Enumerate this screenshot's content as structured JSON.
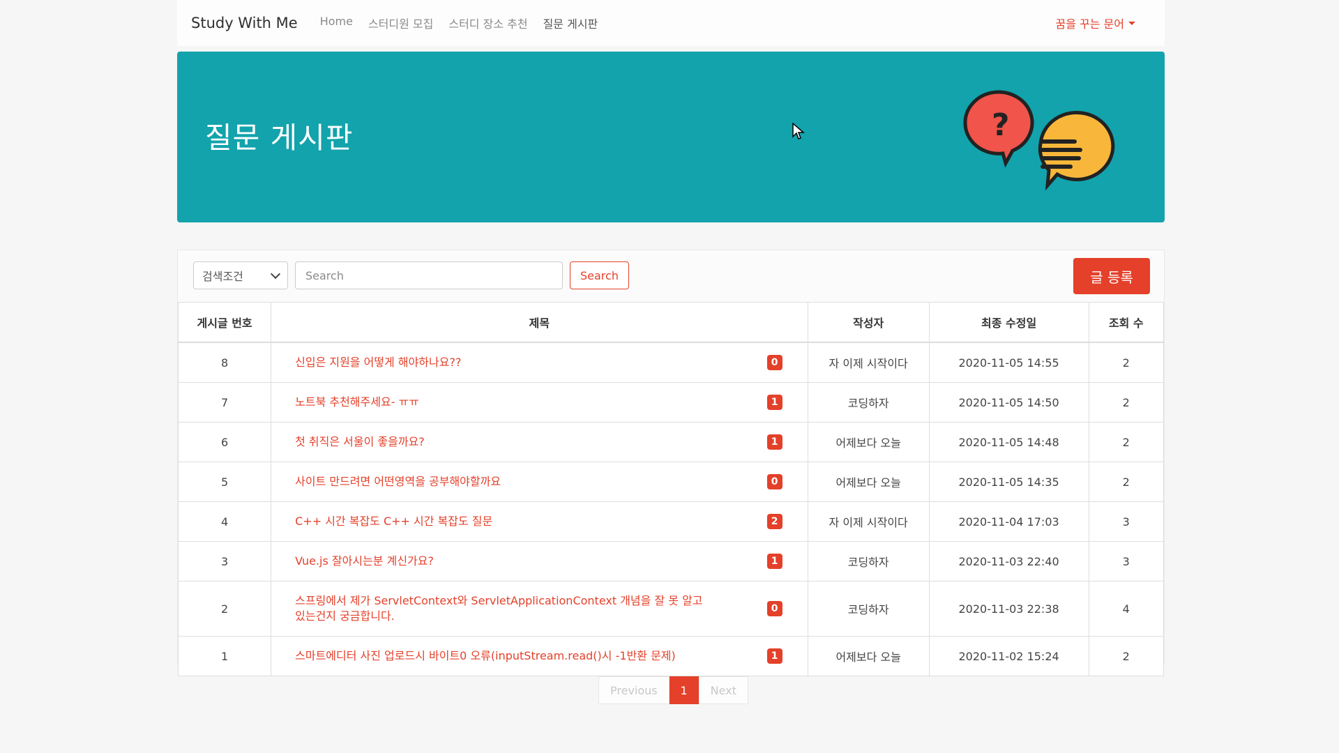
{
  "nav": {
    "brand": "Study With Me",
    "links": [
      "Home",
      "스터디원 모집",
      "스터디 장소 추천",
      "질문 게시판"
    ],
    "user": "꿈을 꾸는 문어"
  },
  "hero": {
    "title": "질문 게시판"
  },
  "toolbar": {
    "select_value": "검색조건",
    "search_placeholder": "Search",
    "search_button": "Search",
    "write_button": "글 등록"
  },
  "table": {
    "headers": [
      "게시글 번호",
      "제목",
      "작성자",
      "최종 수정일",
      "조회 수"
    ],
    "rows": [
      {
        "no": "8",
        "title": "신입은 지원을 어떻게 해야하나요??",
        "comments": "0",
        "author": "자 이제 시작이다",
        "date": "2020-11-05 14:55",
        "views": "2"
      },
      {
        "no": "7",
        "title": "노트북 추천해주세요- ㅠㅠ",
        "comments": "1",
        "author": "코딩하자",
        "date": "2020-11-05 14:50",
        "views": "2"
      },
      {
        "no": "6",
        "title": "첫 취직은 서울이 좋을까요?",
        "comments": "1",
        "author": "어제보다 오늘",
        "date": "2020-11-05 14:48",
        "views": "2"
      },
      {
        "no": "5",
        "title": "사이트 만드려면 어떤영역을 공부해야할까요",
        "comments": "0",
        "author": "어제보다 오늘",
        "date": "2020-11-05 14:35",
        "views": "2"
      },
      {
        "no": "4",
        "title": "C++ 시간 복잡도 C++ 시간 복잡도 질문",
        "comments": "2",
        "author": "자 이제 시작이다",
        "date": "2020-11-04 17:03",
        "views": "3"
      },
      {
        "no": "3",
        "title": "Vue.js 잘아시는분 계신가요?",
        "comments": "1",
        "author": "코딩하자",
        "date": "2020-11-03 22:40",
        "views": "3"
      },
      {
        "no": "2",
        "title": "스프링에서 제가 ServletContext와 ServletApplicationContext 개념을 잘 못 알고 있는건지 궁금합니다.",
        "comments": "0",
        "author": "코딩하자",
        "date": "2020-11-03 22:38",
        "views": "4"
      },
      {
        "no": "1",
        "title": "스마트에디터 사진 업로드시 바이트0 오류(inputStream.read()시 -1반환 문제)",
        "comments": "1",
        "author": "어제보다 오늘",
        "date": "2020-11-02 15:24",
        "views": "2"
      }
    ]
  },
  "pagination": {
    "previous": "Previous",
    "current": "1",
    "next": "Next"
  },
  "colors": {
    "accent": "#e4402a",
    "hero_bg": "#12a3ac"
  },
  "icons": [
    "question-chat-icon",
    "message-chat-icon",
    "chevron-down-icon",
    "caret-down-icon",
    "mouse-cursor-icon"
  ]
}
